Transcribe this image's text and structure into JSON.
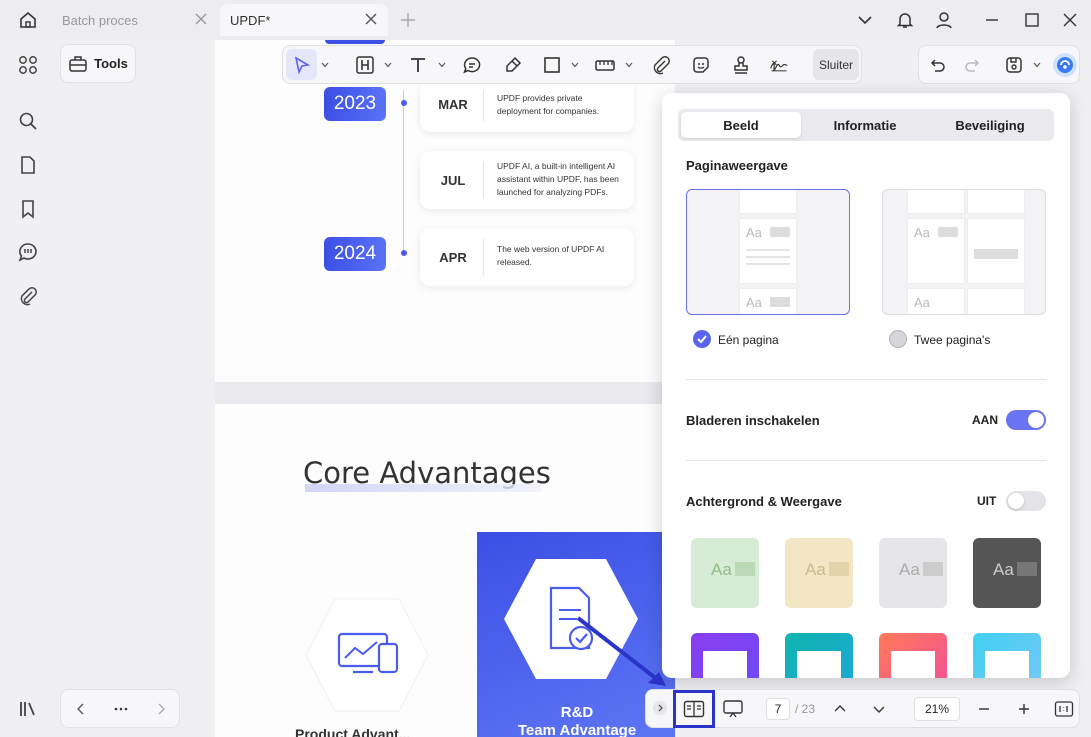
{
  "tabs": [
    {
      "label": "Batch proces"
    },
    {
      "label": "UPDF*"
    }
  ],
  "tools_label": "Tools",
  "toolbar": {
    "close_label": "Sluiter"
  },
  "timeline": [
    {
      "year": "2023",
      "month": "MAR",
      "text": "UPDF provides private deployment for companies."
    },
    {
      "month": "JUL",
      "text": "UPDF AI, a built-in intelligent AI assistant within UPDF, has been launched for analyzing PDFs."
    },
    {
      "year": "2024",
      "month": "APR",
      "text": "The web version of UPDF AI released."
    }
  ],
  "page2": {
    "heading": "Core Advantages",
    "card1": "Product Advant...",
    "card2_line1": "R&D",
    "card2_line2": "Team Advantage"
  },
  "popup": {
    "tabs": [
      "Beeld",
      "Informatie",
      "Beveiliging"
    ],
    "active_tab": "Beeld",
    "page_view_title": "Paginaweergave",
    "option_single": "Eén pagina",
    "option_double": "Twee pagina's",
    "scroll_label": "Bladeren inschakelen",
    "scroll_state": "AAN",
    "bg_label": "Achtergrond & Weergave",
    "bg_state": "UIT",
    "thumb_text": "Aa"
  },
  "pager": {
    "current": "7",
    "total": "/ 23",
    "zoom": "21%"
  },
  "colors": {
    "accent": "#5b64f0",
    "blue": "#3c4fe6",
    "annotation_box": "#2a34c9"
  }
}
